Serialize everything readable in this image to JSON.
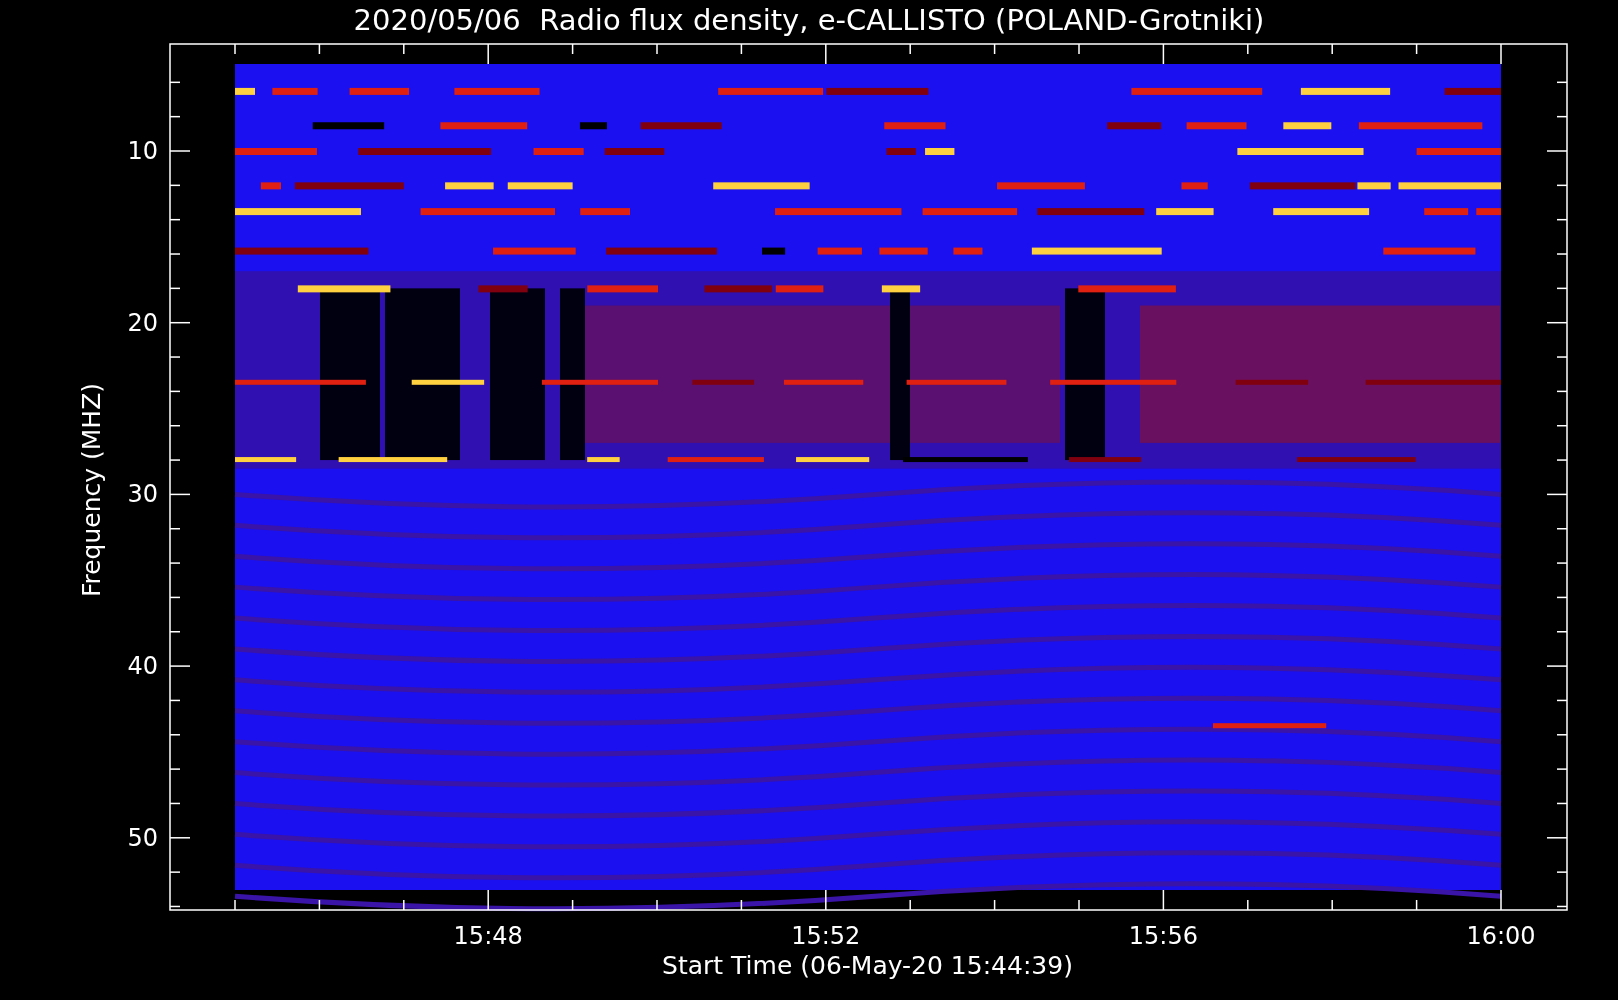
{
  "title": "2020/05/06  Radio flux density, e-CALLISTO (POLAND-Grotniki)",
  "y_axis": {
    "label": "Frequency (MHZ)",
    "ticks": [
      "10",
      "20",
      "30",
      "40",
      "50"
    ]
  },
  "x_axis": {
    "label": "Start Time (06-May-20 15:44:39)",
    "ticks": [
      "15:48",
      "15:52",
      "15:56",
      "16:00"
    ]
  }
}
